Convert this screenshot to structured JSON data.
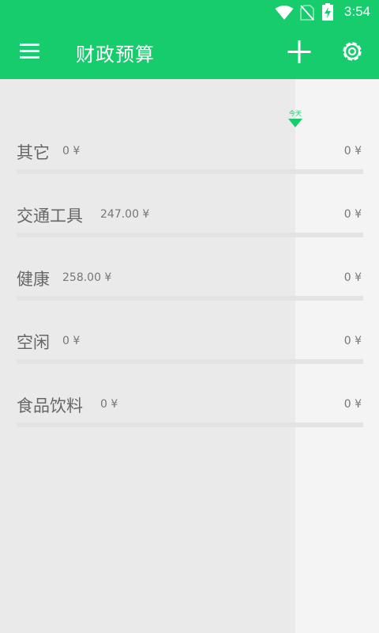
{
  "status_bar": {
    "time": "3:54",
    "icons": [
      "wifi-icon",
      "no-sim-icon",
      "battery-charging-icon"
    ]
  },
  "app_bar": {
    "title": "财政预算",
    "icons": [
      "menu-icon",
      "add-icon",
      "settings-icon"
    ]
  },
  "timeline": {
    "today_label": "今天"
  },
  "categories": [
    {
      "name": "其它",
      "amount": "0 ¥",
      "budget": "0 ¥"
    },
    {
      "name": "交通工具",
      "amount": "247.00 ¥",
      "budget": "0 ¥"
    },
    {
      "name": "健康",
      "amount": "258.00 ¥",
      "budget": "0 ¥"
    },
    {
      "name": "空闲",
      "amount": "0 ¥",
      "budget": "0 ¥"
    },
    {
      "name": "食品饮料",
      "amount": "0 ¥",
      "budget": "0 ¥"
    }
  ],
  "colors": {
    "accent": "#16cc6c",
    "background": "#f4f4f4",
    "elapsed_background": "#eaeaea",
    "progress_track": "#e3e3e3"
  }
}
